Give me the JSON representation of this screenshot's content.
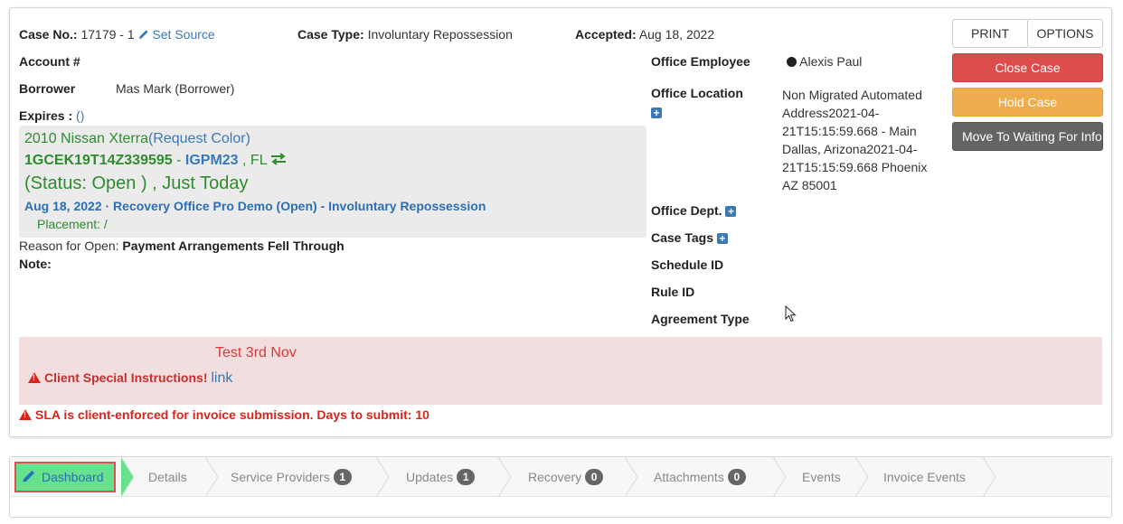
{
  "case": {
    "case_no_label": "Case No.:",
    "case_no_value": "17179 - 1",
    "set_source": "Set Source",
    "case_type_label": "Case Type:",
    "case_type_value": "Involuntary Repossession",
    "accepted_label": "Accepted:",
    "accepted_value": "Aug 18, 2022",
    "account_label": "Account #",
    "borrower_label": "Borrower",
    "borrower_value": "Mas Mark (Borrower)",
    "expires_label": "Expires :",
    "expires_value": "()"
  },
  "vehicle": {
    "name": "2010 Nissan Xterra",
    "paren_open": "(",
    "request_color": "Request Color",
    "paren_close": ")",
    "vin": "1GCEK19T14Z339595",
    "sep": "-",
    "plate": "IGPM23",
    "state": ", FL",
    "status": "(Status: Open ) , Just Today",
    "order_line": "Aug 18, 2022 · Recovery Office Pro Demo (Open) - Involuntary Repossession",
    "placement": "Placement: /"
  },
  "reason": {
    "label": "Reason for Open:",
    "value": "Payment Arrangements Fell Through",
    "note_label": "Note:"
  },
  "office": {
    "employee_label": "Office Employee",
    "employee_value": "Alexis Paul",
    "location_label": "Office Location",
    "location_lines": [
      "Non Migrated Automated",
      "Address2021-04-",
      "21T15:15:59.668 - Main",
      "Dallas, Arizona2021-04-",
      "21T15:15:59.668 Phoenix",
      "AZ 85001"
    ],
    "dept_label": "Office Dept.",
    "tags_label": "Case Tags",
    "schedule_label": "Schedule ID",
    "rule_label": "Rule ID",
    "agreement_label": "Agreement Type"
  },
  "actions": {
    "print": "PRINT",
    "options": "OPTIONS",
    "close_case": "Close Case",
    "hold_case": "Hold Case",
    "move_waiting": "Move To Waiting For Info"
  },
  "alerts": {
    "note": "Test 3rd Nov",
    "client_special": "Client Special Instructions!",
    "link": "link",
    "sla": "SLA is client-enforced for invoice submission. Days to submit: 10"
  },
  "tabs": [
    {
      "label": "Dashboard"
    },
    {
      "label": "Details"
    },
    {
      "label": "Service Providers",
      "badge": "1"
    },
    {
      "label": "Updates",
      "badge": "1"
    },
    {
      "label": "Recovery",
      "badge": "0"
    },
    {
      "label": "Attachments",
      "badge": "0"
    },
    {
      "label": "Events"
    },
    {
      "label": "Invoice Events"
    }
  ],
  "colors": {
    "link": "#3a78b6",
    "green": "#2e8b2e",
    "danger": "#dc4c4c",
    "warning": "#efad4d",
    "dark": "#646464",
    "active_tab": "#66e28e"
  }
}
